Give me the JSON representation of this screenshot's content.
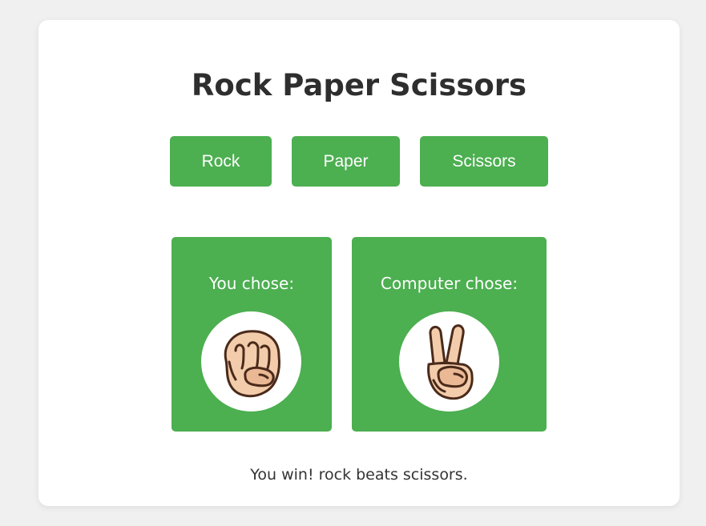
{
  "game": {
    "title": "Rock Paper Scissors",
    "buttons": {
      "rock": "Rock",
      "paper": "Paper",
      "scissors": "Scissors"
    },
    "player": {
      "label": "You chose:",
      "choice_icon": "rock-fist-icon"
    },
    "computer": {
      "label": "Computer chose:",
      "choice_icon": "scissors-peace-hand-icon"
    },
    "result": "You win! rock beats scissors."
  },
  "colors": {
    "accent": "#4caf50",
    "background": "#f0f0f0",
    "card": "#ffffff",
    "title_text": "#2e2e2e",
    "skin": "#f3ccab",
    "outline": "#4a2a1a"
  }
}
